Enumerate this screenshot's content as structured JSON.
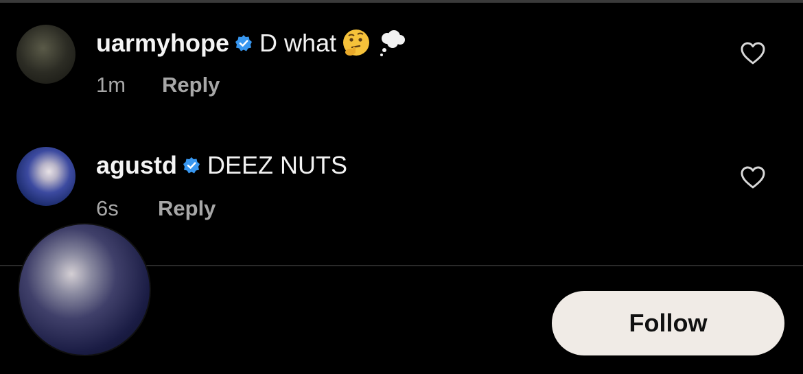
{
  "comments": [
    {
      "username": "uarmyhope",
      "text": "D what",
      "emoji": [
        "thinking-face",
        "thought-balloon"
      ],
      "time": "1m",
      "reply_label": "Reply",
      "verified": true
    },
    {
      "username": "agustd",
      "text": "DEEZ NUTS",
      "time": "6s",
      "reply_label": "Reply",
      "verified": true
    }
  ],
  "follow": {
    "label": "Follow"
  },
  "colors": {
    "background": "#000000",
    "verified_badge": "#3897f0",
    "secondary_text": "#a7a7a7",
    "follow_button_bg": "#f0ebe6"
  }
}
